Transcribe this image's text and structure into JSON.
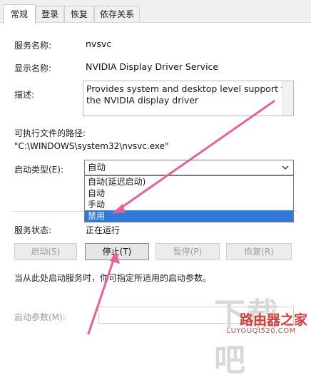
{
  "tabs": [
    {
      "label": "常规",
      "active": true
    },
    {
      "label": "登录",
      "active": false
    },
    {
      "label": "恢复",
      "active": false
    },
    {
      "label": "依存关系",
      "active": false
    }
  ],
  "service": {
    "name_label": "服务名称:",
    "name_value": "nvsvc",
    "display_label": "显示名称:",
    "display_value": "NVIDIA Display Driver Service",
    "desc_label": "描述:",
    "desc_line1": "Provides system and desktop level support to",
    "desc_line2": "the NVIDIA display driver",
    "path_label": "可执行文件的路径:",
    "path_value": "\"C:\\WINDOWS\\system32\\nvsvc.exe\"",
    "startup_label": "启动类型(E):",
    "startup_selected": "自动",
    "startup_options": [
      "自动(延迟启动)",
      "自动",
      "手动",
      "禁用"
    ],
    "status_label": "服务状态:",
    "status_value": "正在运行"
  },
  "buttons": {
    "start": "启动(S)",
    "stop": "停止(T)",
    "pause": "暂停(P)",
    "resume": "恢复(R)"
  },
  "hint_text": "当从此处启动服务时，你可指定所适用的启动参数。",
  "params_label": "启动参数(M):",
  "watermark": {
    "big": "下载吧",
    "logo": "路由器之家",
    "url": "LUYOUQI520.COM"
  },
  "colors": {
    "selection": "#2f7ad8",
    "arrow": "#e8609a"
  }
}
